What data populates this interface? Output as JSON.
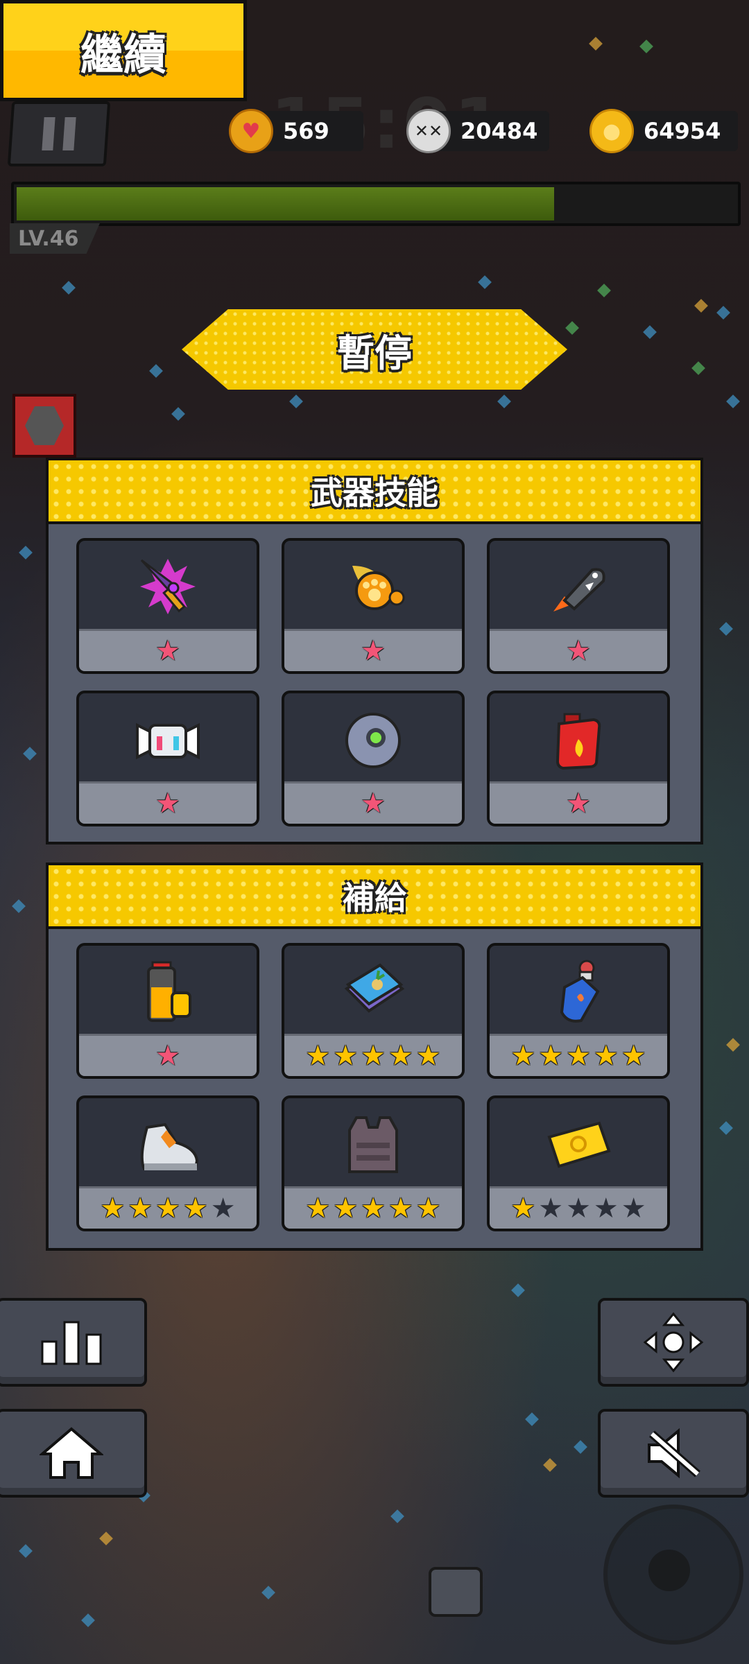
{
  "hud": {
    "timer": "15:01",
    "hearts": "569",
    "kills": "20484",
    "coins": "64954",
    "level": "LV.46",
    "xp_fraction": 0.75
  },
  "title": "暫停",
  "weapons": {
    "header": "武器技能",
    "items": [
      {
        "name": "purple-blade",
        "stars": 1,
        "star_type": "pink"
      },
      {
        "name": "paw-fireball",
        "stars": 1,
        "star_type": "pink"
      },
      {
        "name": "shark-rocket",
        "stars": 1,
        "star_type": "pink"
      },
      {
        "name": "drone-mask",
        "stars": 1,
        "star_type": "pink"
      },
      {
        "name": "green-orb",
        "stars": 1,
        "star_type": "pink"
      },
      {
        "name": "fuel-can",
        "stars": 1,
        "star_type": "pink"
      }
    ]
  },
  "supplies": {
    "header": "補給",
    "items": [
      {
        "name": "battery",
        "stars": 1,
        "of": 1,
        "star_type": "pink"
      },
      {
        "name": "map-book",
        "stars": 5,
        "of": 5,
        "star_type": "gold"
      },
      {
        "name": "potion",
        "stars": 5,
        "of": 5,
        "star_type": "gold"
      },
      {
        "name": "sneaker",
        "stars": 4,
        "of": 5,
        "star_type": "gold"
      },
      {
        "name": "armor-vest",
        "stars": 5,
        "of": 5,
        "star_type": "gold"
      },
      {
        "name": "gold-ticket",
        "stars": 1,
        "of": 5,
        "star_type": "gold"
      }
    ]
  },
  "buttons": {
    "continue": "繼續"
  },
  "colors": {
    "accent_yellow": "#f6c800",
    "panel": "#555b6a",
    "xp_green": "#4f6f14"
  }
}
